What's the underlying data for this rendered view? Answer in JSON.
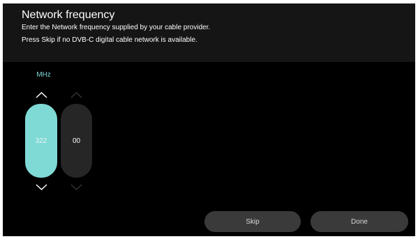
{
  "dialog": {
    "title": "Network frequency",
    "description_line1": "Enter the Network frequency supplied by your cable provider.",
    "description_line2": "Press Skip if no DVB-C digital cable network is available."
  },
  "frequency_input": {
    "unit": "MHz",
    "fields": [
      {
        "value": "322",
        "state": "focused"
      },
      {
        "value": "00",
        "state": "unfocused"
      }
    ],
    "icons": {
      "up": "chevron-up-icon",
      "down": "chevron-down-icon"
    }
  },
  "buttons": {
    "skip_label": "Skip",
    "done_label": "Done"
  },
  "colors": {
    "accent": "#7fd9d4",
    "background": "#000000",
    "header_background": "#151515",
    "inactive_field": "#262626",
    "button": "#3a3a3a"
  }
}
